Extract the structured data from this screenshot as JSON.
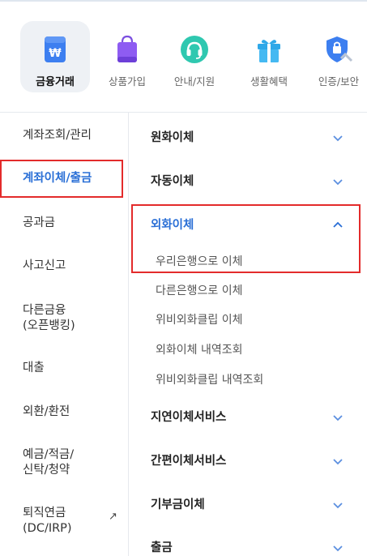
{
  "categories": [
    {
      "label": "금융거래",
      "icon": "won-card-icon",
      "active": true
    },
    {
      "label": "상품가입",
      "icon": "shopping-bag-icon",
      "active": false
    },
    {
      "label": "안내/지원",
      "icon": "headset-icon",
      "active": false
    },
    {
      "label": "생활혜택",
      "icon": "gift-icon",
      "active": false
    },
    {
      "label": "인증/보안",
      "icon": "shield-check-icon",
      "active": false
    }
  ],
  "left_menu": [
    {
      "label": "계좌조회/관리"
    },
    {
      "label": "계좌이체/출금",
      "selected": true
    },
    {
      "label": "공과금"
    },
    {
      "label": "사고신고"
    },
    {
      "label": "다른금융\n(오픈뱅킹)"
    },
    {
      "label": "대출"
    },
    {
      "label": "외환/환전"
    },
    {
      "label": "예금/적금/\n신탁/청약"
    },
    {
      "label": "퇴직연금\n(DC/IRP)",
      "external": true
    }
  ],
  "right_menu": [
    {
      "label": "원화이체",
      "expanded": false
    },
    {
      "label": "자동이체",
      "expanded": false
    },
    {
      "label": "외화이체",
      "expanded": true,
      "sub_items": [
        "우리은행으로 이체",
        "다른은행으로 이체",
        "위비외화클립 이체",
        "외화이체 내역조회",
        "위비외화클립 내역조회"
      ]
    },
    {
      "label": "지연이체서비스",
      "expanded": false
    },
    {
      "label": "간편이체서비스",
      "expanded": false
    },
    {
      "label": "기부금이체",
      "expanded": false
    },
    {
      "label": "출금",
      "expanded": false
    }
  ],
  "external_arrow": "↗",
  "colors": {
    "accent": "#2a6fd6",
    "highlight": "#e32b2b",
    "active_tile": "#eef1f5"
  }
}
